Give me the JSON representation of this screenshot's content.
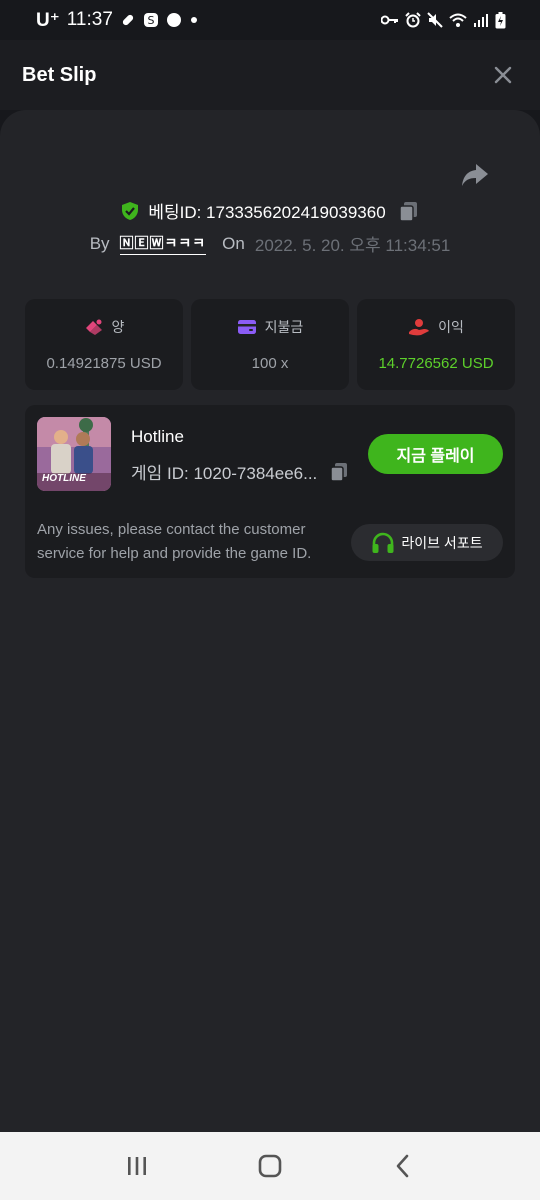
{
  "status_bar": {
    "carrier": "U⁺",
    "time": "11:37"
  },
  "header": {
    "title": "Bet Slip",
    "close_icon": "close-icon"
  },
  "bet": {
    "id_label": "베팅ID: 1733356202419039360",
    "by_label": "By",
    "username": "🄽🄴🅆ㅋㅋㅋ",
    "on_label": "On",
    "date": "2022. 5. 20. 오후 11:34:51"
  },
  "stats": [
    {
      "icon": "bet-amount-icon",
      "label": "양",
      "value": "0.14921875 USD",
      "color": "#e0457b"
    },
    {
      "icon": "wallet-icon",
      "label": "지불금",
      "value": "100 x",
      "color": "#8b5cf6"
    },
    {
      "icon": "profit-icon",
      "label": "이익",
      "value": "14.7726562 USD",
      "color": "#e03c3c"
    }
  ],
  "game": {
    "name": "Hotline",
    "thumb_label": "HOTLINE",
    "id_label": "게임 ID: 1020-7384ee6...",
    "play_label": "지금 플레이",
    "help_text": "Any issues, please contact the customer service for help and provide the game ID.",
    "support_label": "라이브 서포트"
  },
  "colors": {
    "accent_green": "#3fb51d",
    "profit_green": "#5dd02b",
    "background": "#17181c",
    "card": "#1b1c1f",
    "sheet": "#232428"
  }
}
